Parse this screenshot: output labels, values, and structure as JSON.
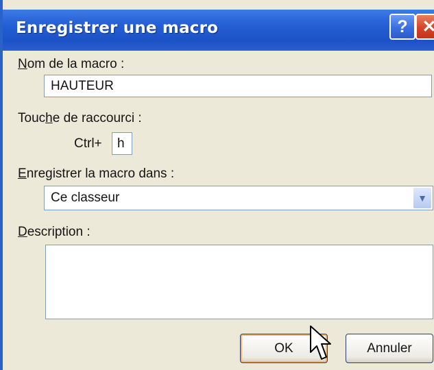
{
  "dialog": {
    "title": "Enregistrer une macro",
    "help_glyph": "?",
    "close_glyph": "✕"
  },
  "macro_name": {
    "label_accel": "N",
    "label_rest": "om de la macro :",
    "value": "HAUTEUR"
  },
  "shortcut": {
    "label_pre": "Touc",
    "label_accel": "h",
    "label_post": "e de raccourci :",
    "prefix": "Ctrl+",
    "value": "h"
  },
  "store_in": {
    "label_accel": "E",
    "label_rest": "nregistrer la macro dans :",
    "selected": "Ce classeur"
  },
  "description": {
    "label_accel": "D",
    "label_rest": "escription :",
    "value": ""
  },
  "buttons": {
    "ok": "OK",
    "cancel": "Annuler"
  },
  "colors": {
    "titlebar": "#2560d6",
    "dialog_bg": "#ece9d8",
    "close_button": "#d6452a",
    "default_button_highlight": "#f2b46a"
  },
  "icons": {
    "help": "help-icon",
    "close": "close-icon",
    "dropdown": "chevron-down-icon",
    "cursor": "mouse-pointer-icon"
  }
}
